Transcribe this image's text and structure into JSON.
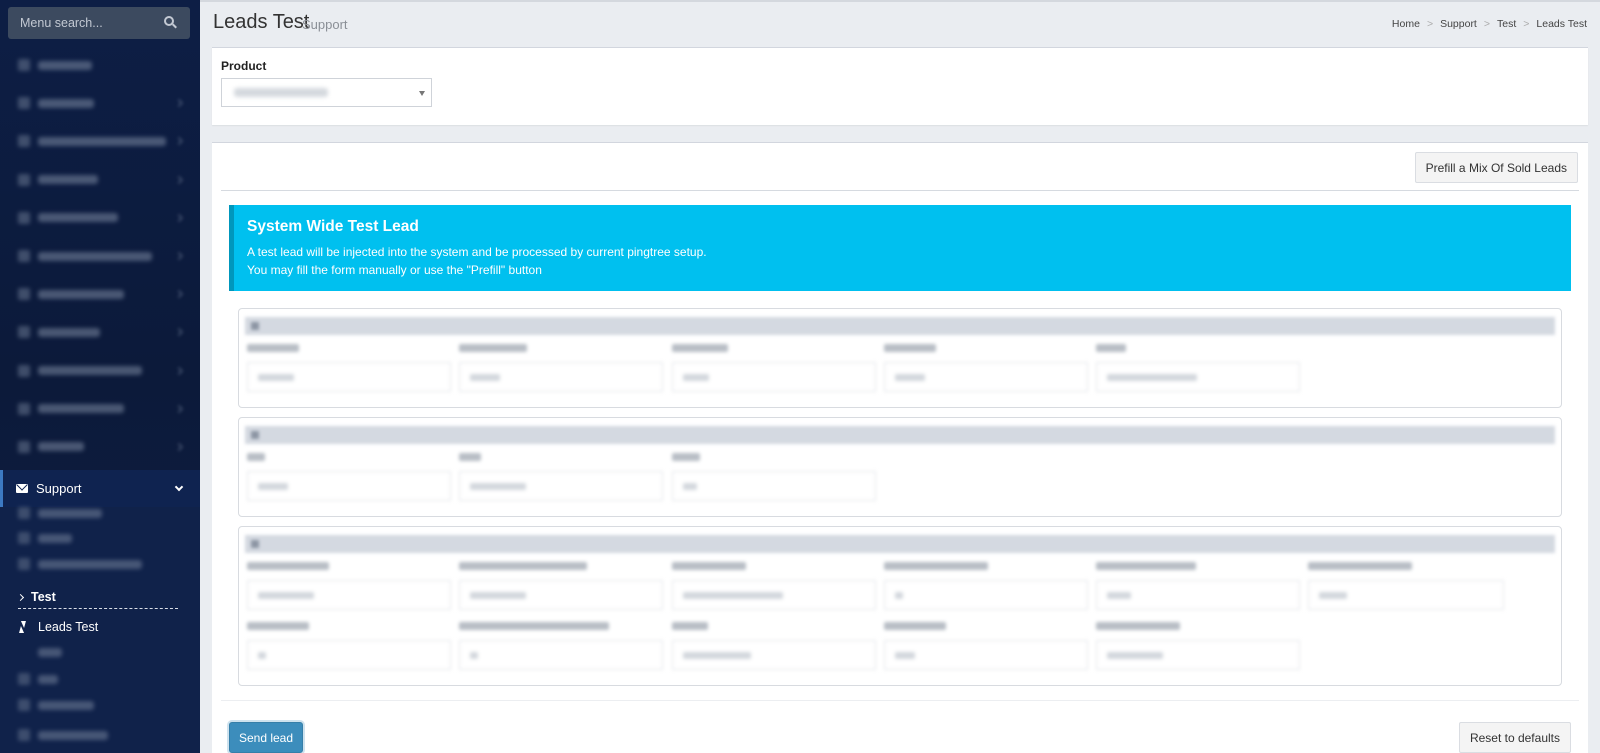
{
  "sidebar": {
    "search_placeholder": "Menu search...",
    "support_label": "Support",
    "test_label": "Test",
    "leads_test_label": "Leads Test"
  },
  "header": {
    "title": "Leads Test",
    "subtitle": "Support",
    "breadcrumb": [
      "Home",
      "Support",
      "Test",
      "Leads Test"
    ],
    "breadcrumb_separator": ">"
  },
  "product": {
    "label": "Product"
  },
  "toolbar": {
    "prefill_label": "Prefill a Mix Of Sold Leads"
  },
  "callout": {
    "title": "System Wide Test Lead",
    "line1": "A test lead will be injected into the system and be processed by current pingtree setup.",
    "line2": "You may fill the form manually or use the \"Prefill\" button"
  },
  "actions": {
    "send_label": "Send lead",
    "reset_label": "Reset to defaults"
  },
  "colors": {
    "sidebar_bg": "#0d1e45",
    "callout_bg": "#00c0ef",
    "primary_button": "#3c8dbc"
  }
}
